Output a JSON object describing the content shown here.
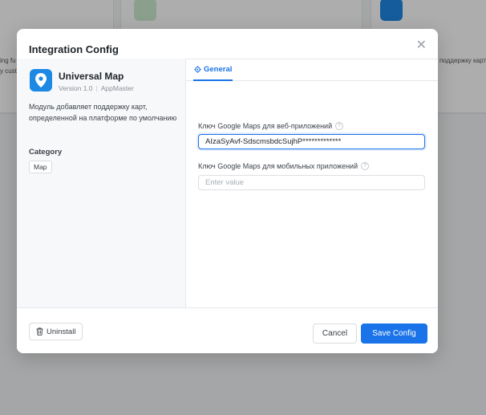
{
  "background": {
    "left_card_lines": [
      "ing fu",
      "y cust"
    ],
    "right_card_line": "поддержку карт"
  },
  "modal": {
    "title": "Integration Config",
    "close_icon": "close-icon"
  },
  "app": {
    "name": "Universal Map",
    "version": "Version 1.0",
    "vendor": "AppMaster",
    "description": "Модуль добавляет поддержку карт, определенной на платформе по умолчанию",
    "icon": "map-pin-icon",
    "icon_color": "#1e88e5"
  },
  "category": {
    "label": "Category",
    "value": "Map"
  },
  "tabs": [
    {
      "label": "General",
      "icon": "gear-icon",
      "active": true
    }
  ],
  "fields": {
    "web_key": {
      "label": "Ключ Google Maps для веб-приложений",
      "value": "AIzaSyAvf-SdscmsbdcSujhP*************",
      "placeholder": ""
    },
    "mobile_key": {
      "label": "Ключ Google Maps для мобильных приложений",
      "value": "",
      "placeholder": "Enter value"
    }
  },
  "footer": {
    "uninstall_label": "Uninstall",
    "cancel_label": "Cancel",
    "save_label": "Save Config"
  },
  "colors": {
    "accent": "#1a73e8",
    "overlay": "rgba(0,0,0,0.32)"
  }
}
